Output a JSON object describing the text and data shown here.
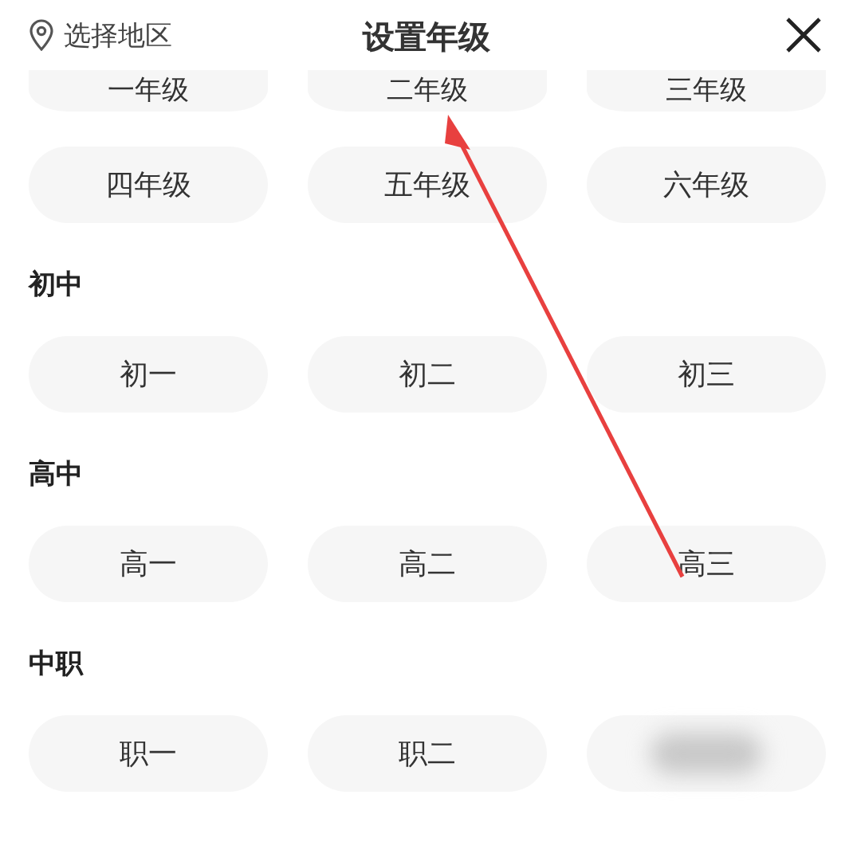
{
  "header": {
    "region": "选择地区",
    "title": "设置年级"
  },
  "groups": [
    {
      "options": [
        {
          "kind": "cut",
          "label": "一年级"
        },
        {
          "kind": "cut",
          "label": "二年级"
        },
        {
          "kind": "cut",
          "label": "三年级"
        }
      ]
    },
    {
      "options": [
        {
          "kind": "text",
          "label": "四年级"
        },
        {
          "kind": "text",
          "label": "五年级"
        },
        {
          "kind": "text",
          "label": "六年级"
        }
      ]
    },
    {
      "heading": "初中",
      "options": [
        {
          "kind": "text",
          "label": "初一"
        },
        {
          "kind": "text",
          "label": "初二"
        },
        {
          "kind": "text",
          "label": "初三"
        }
      ]
    },
    {
      "heading": "高中",
      "options": [
        {
          "kind": "text",
          "label": "高一"
        },
        {
          "kind": "text",
          "label": "高二"
        },
        {
          "kind": "text",
          "label": "高三"
        }
      ]
    },
    {
      "heading": "中职",
      "options": [
        {
          "kind": "text",
          "label": "职一"
        },
        {
          "kind": "text",
          "label": "职二"
        },
        {
          "kind": "blurred"
        }
      ]
    }
  ]
}
